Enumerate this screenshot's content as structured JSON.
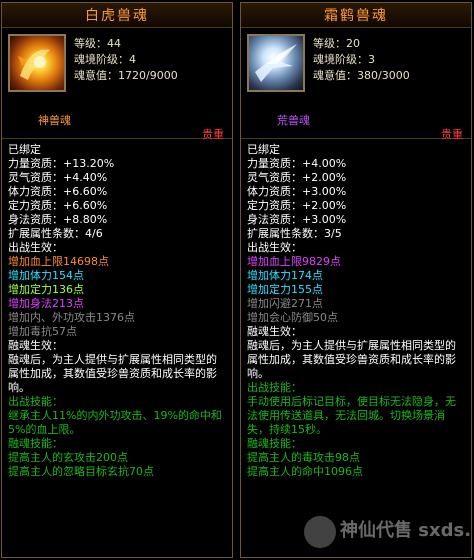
{
  "left": {
    "title": "白虎兽魂",
    "icon": "tiger-spirit-icon",
    "level": "等级：44",
    "realm": "魂境阶级：4",
    "soul": "魂意值：1720/9000",
    "type": "神兽魂",
    "guizhong": "贵重",
    "bound": "已绑定",
    "attrs": [
      "力量资质：+13.20%",
      "灵气资质：+4.40%",
      "体力资质：+6.60%",
      "定力资质：+6.60%",
      "身法资质：+8.80%"
    ],
    "ext": "扩展属性条数：4/6",
    "battle_label": "出战生效：",
    "battle": [
      {
        "text": "增加血上限14698点",
        "color": "#ff8a2a"
      },
      {
        "text": "增加体力154点",
        "color": "#2ae0ff"
      },
      {
        "text": "增加定力136点",
        "color": "#a0ff40"
      },
      {
        "text": "增加身法213点",
        "color": "#e040ff"
      },
      {
        "text": "增加内、外功攻击1376点",
        "color": "#8a8a8a"
      },
      {
        "text": "增加毒抗57点",
        "color": "#8a8a8a"
      }
    ],
    "fusion_label": "融魂生效：",
    "fusion_desc": "融魂后，为主人提供与扩展属性相同类型的属性加成，其数值受珍兽资质和成长率的影响。",
    "skill_label": "出战技能：",
    "skill_desc": "继承主人11%的内外功攻击、19%的命中和5%的血上限。",
    "fuse_skill_label": "融魂技能：",
    "fuse_skills": [
      "提高主人的玄攻击200点",
      "提高主人的忽略目标玄抗70点"
    ]
  },
  "right": {
    "title": "霜鹤兽魂",
    "icon": "crane-spirit-icon",
    "level": "等级：20",
    "realm": "魂境阶级：3",
    "soul": "魂意值：380/3000",
    "type": "荒兽魂",
    "guizhong": "贵重",
    "bound": "已绑定",
    "attrs": [
      "力量资质：+4.00%",
      "灵气资质：+2.00%",
      "体力资质：+3.00%",
      "定力资质：+2.00%",
      "身法资质：+3.00%"
    ],
    "ext": "扩展属性条数：3/5",
    "battle_label": "出战生效：",
    "battle": [
      {
        "text": "增加血上限9829点",
        "color": "#e040ff"
      },
      {
        "text": "增加体力174点",
        "color": "#2ae0ff"
      },
      {
        "text": "增加定力155点",
        "color": "#2ae0ff"
      },
      {
        "text": "增加闪避271点",
        "color": "#8a8a8a"
      },
      {
        "text": "增加会心防御50点",
        "color": "#8a8a8a"
      }
    ],
    "fusion_label": "融魂生效：",
    "fusion_desc": "融魂后，为主人提供与扩展属性相同类型的属性加成，其数值受珍兽资质和成长率的影响。",
    "skill_label": "出战技能：",
    "skill_desc": "手动使用后标记目标，使目标无法隐身，无法使用传送道具，无法回城。切换场景消失，持续15秒。",
    "fuse_skill_label": "融魂技能：",
    "fuse_skills": [
      "提高主人的毒攻击98点",
      "提高主人的命中1096点"
    ]
  },
  "watermark": "神仙代售 sxds.com"
}
